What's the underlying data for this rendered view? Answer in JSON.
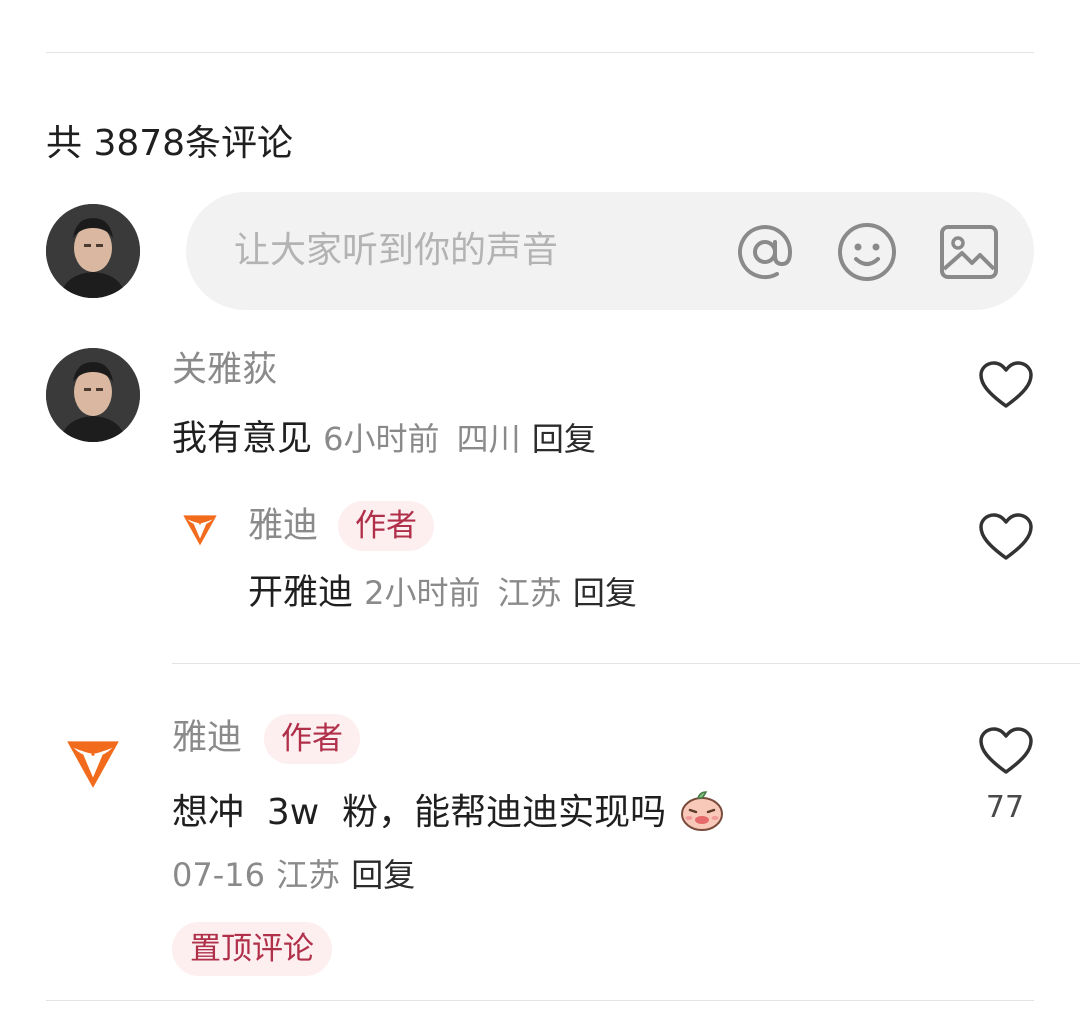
{
  "header": {
    "comment_count_text": "共 3878条评论"
  },
  "input": {
    "placeholder": "让大家听到你的声音",
    "icons": [
      "at-icon",
      "emoji-icon",
      "image-icon"
    ]
  },
  "comments": [
    {
      "username": "关雅荻",
      "text": "我有意见",
      "time": "6小时前",
      "location": "四川",
      "reply_label": "回复",
      "replies": [
        {
          "username": "雅迪",
          "badge": "作者",
          "text": "开雅迪",
          "time": "2小时前",
          "location": "江苏",
          "reply_label": "回复"
        }
      ]
    },
    {
      "username": "雅迪",
      "badge": "作者",
      "text": "想冲  3w  粉，能帮迪迪实现吗",
      "emoji": "face-emoji",
      "likes": "77",
      "date": "07-16",
      "location": "江苏",
      "reply_label": "回复",
      "pinned_label": "置顶评论"
    }
  ],
  "colors": {
    "brand_orange": "#f26a1b",
    "badge_bg": "#fdeef0",
    "badge_text": "#b0304a",
    "divider": "#e3e3e3"
  }
}
